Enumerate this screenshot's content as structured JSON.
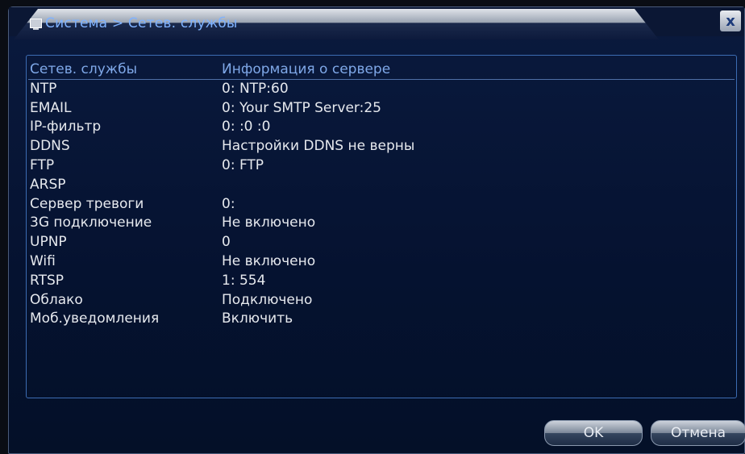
{
  "window": {
    "title": "Система > Сетев. службы",
    "close_label": "x"
  },
  "table": {
    "header": {
      "col1": "Сетев. службы",
      "col2": "Информация о сервере"
    },
    "rows": [
      {
        "service": "NTP",
        "info": "0: NTP:60"
      },
      {
        "service": "EMAIL",
        "info": "0: Your SMTP Server:25"
      },
      {
        "service": "IP-фильтр",
        "info": "0: :0 :0"
      },
      {
        "service": "DDNS",
        "info": "Настройки DDNS не верны"
      },
      {
        "service": "FTP",
        "info": "0: FTP"
      },
      {
        "service": "ARSP",
        "info": ""
      },
      {
        "service": "Сервер тревоги",
        "info": "0:"
      },
      {
        "service": "3G подключение",
        "info": "Не включено"
      },
      {
        "service": "UPNP",
        "info": "0"
      },
      {
        "service": "Wifi",
        "info": "Не включено"
      },
      {
        "service": "RTSP",
        "info": "1: 554"
      },
      {
        "service": "Облако",
        "info": "Подключено"
      },
      {
        "service": "Моб.уведомления",
        "info": "Включить"
      }
    ]
  },
  "buttons": {
    "ok": "OK",
    "cancel": "Отмена"
  }
}
